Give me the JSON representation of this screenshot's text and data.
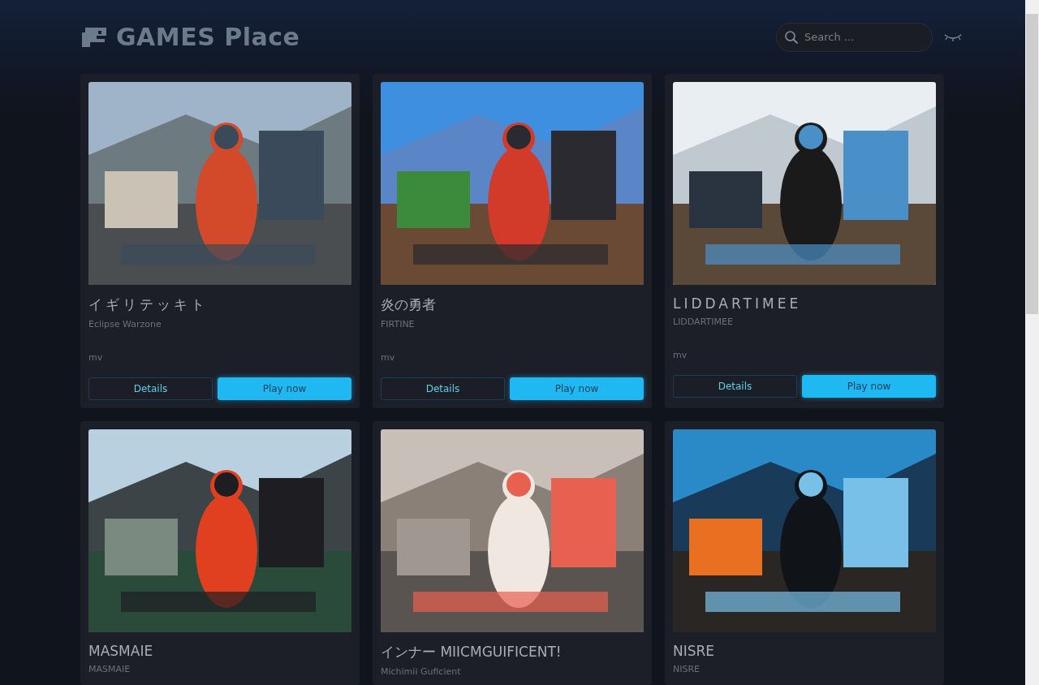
{
  "header": {
    "title": "GAMES Place",
    "search": {
      "placeholder": "Search ..."
    }
  },
  "games": [
    {
      "title": "イギリテッキト",
      "wide": true,
      "subtitle": "Eclipse Warzone",
      "tag": "mv",
      "buttons": [
        "Details",
        "Play now"
      ]
    },
    {
      "title": "炎の勇者",
      "wide": false,
      "subtitle": "FIRTINE",
      "tag": "mv",
      "buttons": [
        "Details",
        "Play now"
      ]
    },
    {
      "title": "LIDDARTIMEE",
      "wide": true,
      "subtitle": "LIDDARTIMEE",
      "tag": "mv",
      "buttons": [
        "Details",
        "Play now"
      ]
    },
    {
      "title": "MASMAIE",
      "wide": false,
      "subtitle": "MASMAIE"
    },
    {
      "title": "インナー MIICMGUIFICENT!",
      "wide": false,
      "subtitle": "Michimii Guficient"
    },
    {
      "title": "NISRE",
      "wide": false,
      "subtitle": "NISRE"
    }
  ]
}
